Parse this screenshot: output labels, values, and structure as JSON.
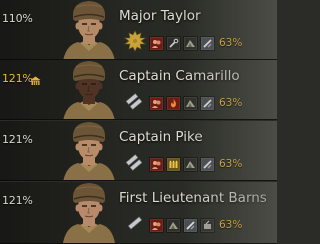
{
  "crew": [
    {
      "name": "Major Taylor",
      "training": "110%",
      "training_highlight": false,
      "barracks_icon": false,
      "rank_icon": "major-oak-leaf-icon",
      "skin": "#b58a66",
      "skills": [
        {
          "icon": "brothers-in-arms-icon",
          "color": "red"
        },
        {
          "icon": "repair-icon",
          "color": "dark"
        },
        {
          "icon": "camouflage-icon",
          "color": "dark"
        },
        {
          "icon": "tool-icon",
          "color": "steel"
        }
      ],
      "skill_progress": "63%"
    },
    {
      "name": "Captain Camarillo",
      "training": "121%",
      "training_highlight": true,
      "barracks_icon": true,
      "rank_icon": "captain-bars-icon",
      "skin": "#4f3324",
      "skills": [
        {
          "icon": "brothers-in-arms-icon",
          "color": "red"
        },
        {
          "icon": "firefighting-icon",
          "color": "red"
        },
        {
          "icon": "camouflage-icon",
          "color": "dark"
        },
        {
          "icon": "tool-icon",
          "color": "steel"
        }
      ],
      "skill_progress": "63%"
    },
    {
      "name": "Captain Pike",
      "training": "121%",
      "training_highlight": false,
      "barracks_icon": false,
      "rank_icon": "captain-bars-icon",
      "skin": "#b88c68",
      "skills": [
        {
          "icon": "brothers-in-arms-icon",
          "color": "red"
        },
        {
          "icon": "ammo-rack-icon",
          "color": "gold"
        },
        {
          "icon": "camouflage-icon",
          "color": "dark"
        },
        {
          "icon": "tool-icon",
          "color": "steel"
        }
      ],
      "skill_progress": "63%"
    },
    {
      "name": "First Lieutenant Barns",
      "training": "121%",
      "training_highlight": false,
      "barracks_icon": false,
      "rank_icon": "lieutenant-bar-icon",
      "skin": "#b8896a",
      "skills": [
        {
          "icon": "brothers-in-arms-icon",
          "color": "red"
        },
        {
          "icon": "camouflage-icon",
          "color": "dark"
        },
        {
          "icon": "tool-icon",
          "color": "steel"
        },
        {
          "icon": "radio-icon",
          "color": "dark"
        }
      ],
      "skill_progress": "63%"
    }
  ]
}
